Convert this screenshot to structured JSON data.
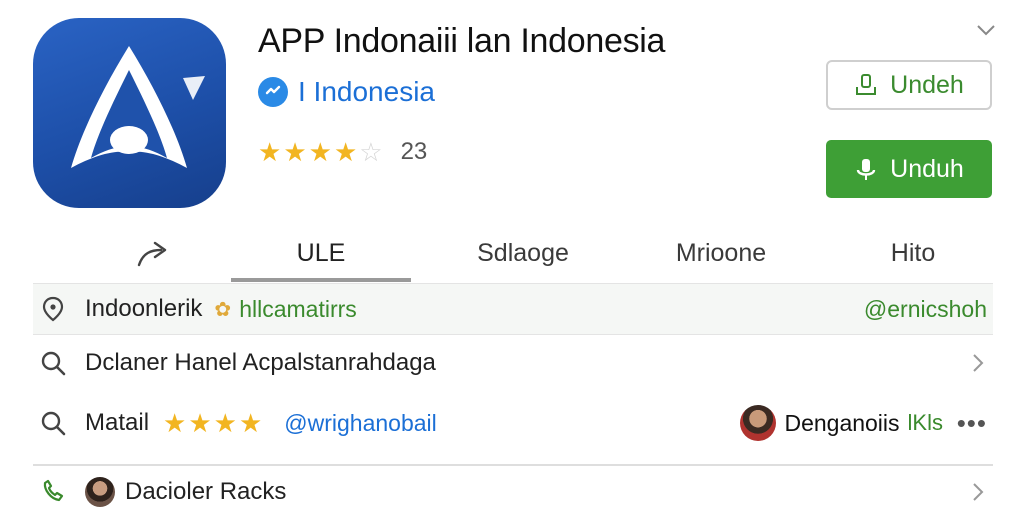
{
  "app": {
    "title": "APP Indonaiii lan Indonesia",
    "publisher": "I Indonesia",
    "rating_count": "23",
    "rating": 3.5,
    "icon": "rocket-app-icon",
    "brand_color": "#1d4fa8"
  },
  "header": {
    "collapse_icon": "chevron-down-icon"
  },
  "buttons": {
    "outline_label": "Undeh",
    "primary_label": "Unduh",
    "primary_color": "#3e9f36"
  },
  "tabs": [
    {
      "label": "ULE"
    },
    {
      "label": "Sdlaoge"
    },
    {
      "label": "Mrioone"
    },
    {
      "label": "Hito"
    }
  ],
  "rows": {
    "location": {
      "title": "Indoonlerik",
      "tag": "hllcamatirrs",
      "handle": "@ernicshoh"
    },
    "search_1": {
      "text": "Dclaner Hanel Acpalstanrahdaga"
    },
    "search_2": {
      "title": "Matail",
      "stars": 4,
      "link": "@wrighanobail",
      "user_name": "Denganoiis",
      "user_suffix": "lKls"
    },
    "call": {
      "text": "Dacioler Racks"
    }
  }
}
